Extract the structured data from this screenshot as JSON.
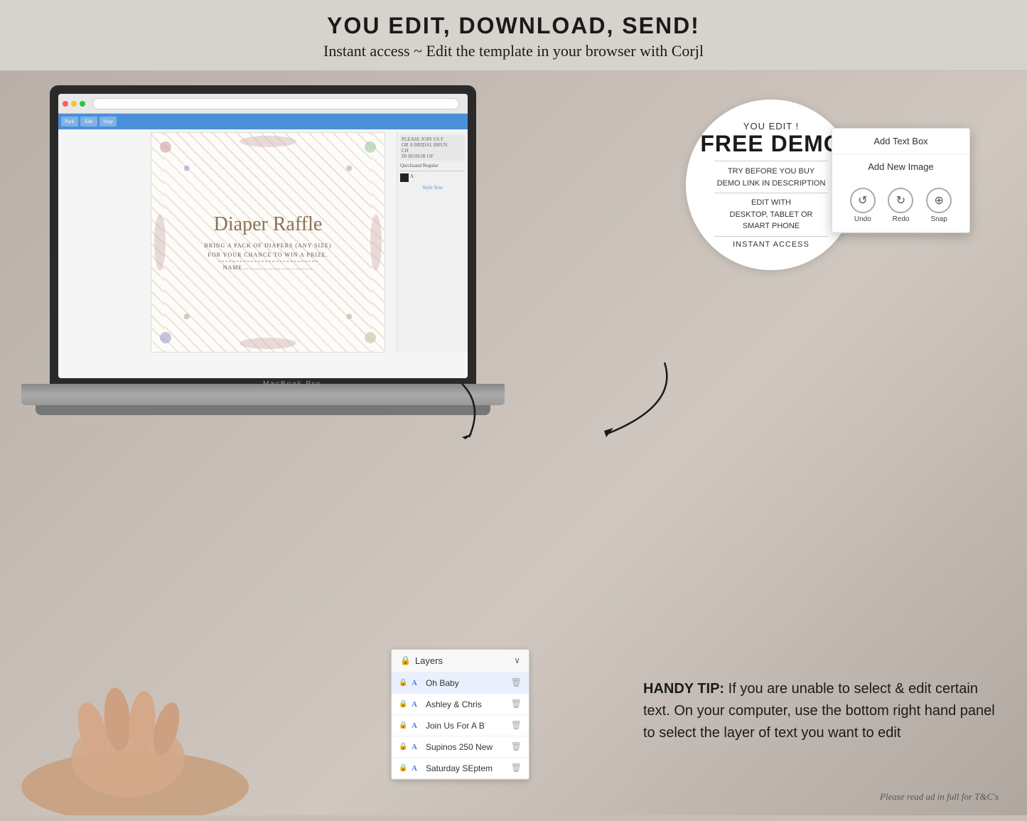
{
  "header": {
    "title": "YOU EDIT, DOWNLOAD, SEND!",
    "subtitle": "Instant access ~ Edit the template in your browser with Corjl"
  },
  "badge": {
    "you_edit": "YOU EDIT !",
    "free_demo": "FREE DEMO",
    "try_before": "TRY BEFORE YOU BUY",
    "demo_link": "DEMO LINK IN DESCRIPTION",
    "edit_with": "EDIT WITH",
    "devices": "DESKTOP, TABLET OR",
    "smartphone": "SMART PHONE",
    "instant": "INSTANT ACCESS"
  },
  "corjl_panel": {
    "btn1": "Add Text Box",
    "btn2": "Add New Image",
    "icon1_label": "Undo",
    "icon2_label": "Redo",
    "icon3_label": "Snap"
  },
  "layers_panel": {
    "title": "Layers",
    "items": [
      {
        "name": "Oh Baby",
        "type": "A",
        "locked": true
      },
      {
        "name": "Ashley & Chris",
        "type": "A",
        "locked": true
      },
      {
        "name": "Join Us For A B",
        "type": "A",
        "locked": true
      },
      {
        "name": "Supinos 250 New",
        "type": "A",
        "locked": true
      },
      {
        "name": "Saturday SEptem",
        "type": "A",
        "locked": true
      }
    ]
  },
  "design": {
    "title": "Diaper Raffle",
    "line1": "BRING A PACK OF DIAPERS (ANY SIZE)",
    "line2": "FOR YOUR CHANCE TO WIN A PRIZE.",
    "line3": "NAME................................."
  },
  "tip": {
    "label": "HANDY TIP:",
    "text": "If you are unable to select & edit certain text. On your computer, use the bottom right hand panel to select the layer of text you want to edit"
  },
  "footer": {
    "disclaimer": "Please read ad in full for T&C's"
  },
  "macbook": {
    "label": "MacBook Pro"
  }
}
